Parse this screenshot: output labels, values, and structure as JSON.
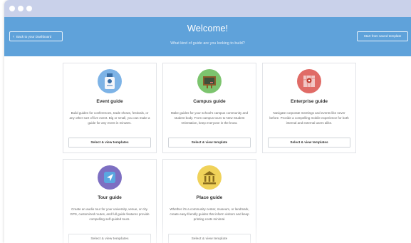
{
  "header": {
    "back_label": "Back to your Dashboard",
    "title": "Welcome!",
    "subtitle": "What kind of guide are you looking to build?",
    "saved_template_label": "Start from saved template"
  },
  "guides": [
    {
      "title": "Event guide",
      "description": "Build guides for conferences, trade shows, festivals, or any other sort of live event. Big or small, you can make a guide for any event in minutes.",
      "button_label": "Select & view templates",
      "icon": "badge-icon",
      "icon_color": "#4c8ad0"
    },
    {
      "title": "Campus guide",
      "description": "Make guides for your school's campus community and student body. From campus tours to New Student Orientation, keep everyone in the know.",
      "button_label": "Select & view template",
      "icon": "chalkboard-icon",
      "icon_color": "#5cae58"
    },
    {
      "title": "Enterprise guide",
      "description": "Navigate corporate meetings and events like never before. Provide a compelling mobile experience for both internal and external users alike.",
      "button_label": "Select & view templates",
      "icon": "map-icon",
      "icon_color": "#d9534f"
    },
    {
      "title": "Tour guide",
      "description": "Create an audio tour for your university, venue, or city. GPS, customized routes, and full guide features provide compelling self-guided tours.",
      "button_label": "Select & view templates",
      "icon": "compass-icon",
      "icon_color": "#6f5fb0"
    },
    {
      "title": "Place guide",
      "description": "Whether it's a community center, museum, or landmark, create easy-friendly guides that inform visitors and keep printing costs minimal.",
      "button_label": "Select & view template",
      "icon": "museum-icon",
      "icon_color": "#e7c23c"
    }
  ]
}
